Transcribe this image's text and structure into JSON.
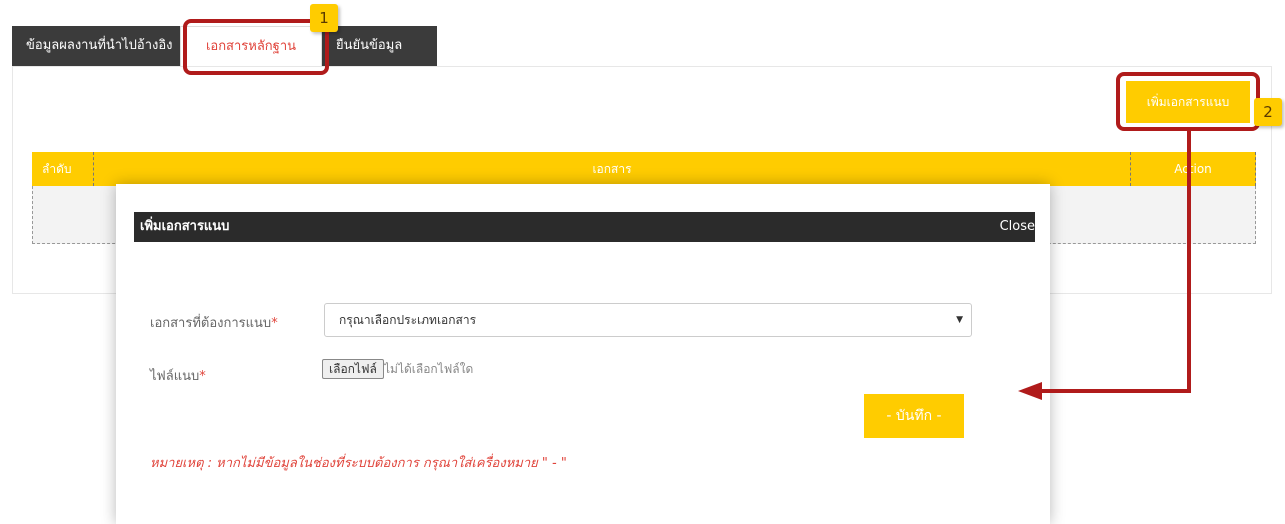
{
  "tabs": [
    {
      "label": "ข้อมูลผลงานที่นำไปอ้างอิง"
    },
    {
      "label": "เอกสารหลักฐาน"
    },
    {
      "label": "ยืนยันข้อมูล"
    }
  ],
  "toolbar": {
    "add_label": "เพิ่มเอกสารแนบ"
  },
  "table": {
    "columns": [
      "ลำดับ",
      "เอกสาร",
      "Action"
    ]
  },
  "annotations": {
    "one": "1",
    "two": "2"
  },
  "modal": {
    "title": "เพิ่มเอกสารแนบ",
    "close_label": "Close",
    "doc_label": "เอกสารที่ต้องการแนบ",
    "required_mark": "*",
    "select_value": "กรุณาเลือกประเภทเอกสาร",
    "file_label": "ไฟล์แนบ",
    "file_button": "เลือกไฟล์",
    "file_status": "ไม่ได้เลือกไฟล์ใด",
    "save_label": "- บันทึก -",
    "note": "หมายเหตุ : หากไม่มีข้อมูลในช่องที่ระบบต้องการ กรุณาใส่เครื่องหมาย \" - \""
  },
  "colors": {
    "accent": "#ffcc00",
    "annotation": "#b01b1b",
    "dark": "#2b2b2b",
    "required": "#e0433a"
  }
}
